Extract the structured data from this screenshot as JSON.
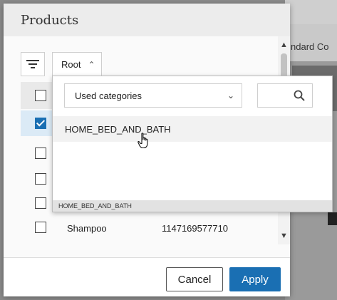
{
  "background": {
    "partial_text": "ndard Co"
  },
  "dialog": {
    "title": "Products",
    "toolbar": {
      "filter_icon": "filter-icon",
      "root_label": "Root"
    },
    "table": {
      "rows": [
        {
          "name": "",
          "id": "",
          "checked": false
        },
        {
          "name": "",
          "id": "",
          "checked": true
        },
        {
          "name": "",
          "id": "",
          "checked": false
        },
        {
          "name": "",
          "id": "",
          "checked": false
        },
        {
          "name": "",
          "id": "",
          "checked": false
        },
        {
          "name": "Shampoo",
          "id": "1147169577710",
          "checked": false
        }
      ]
    },
    "footer": {
      "cancel_label": "Cancel",
      "apply_label": "Apply"
    }
  },
  "popover": {
    "category_select": "Used categories",
    "search_placeholder": "",
    "items": [
      "HOME_BED_AND_BATH"
    ],
    "footer_path": "HOME_BED_AND_BATH"
  },
  "colors": {
    "primary": "#1a6fb3",
    "selected_row": "#dbeaf6"
  }
}
